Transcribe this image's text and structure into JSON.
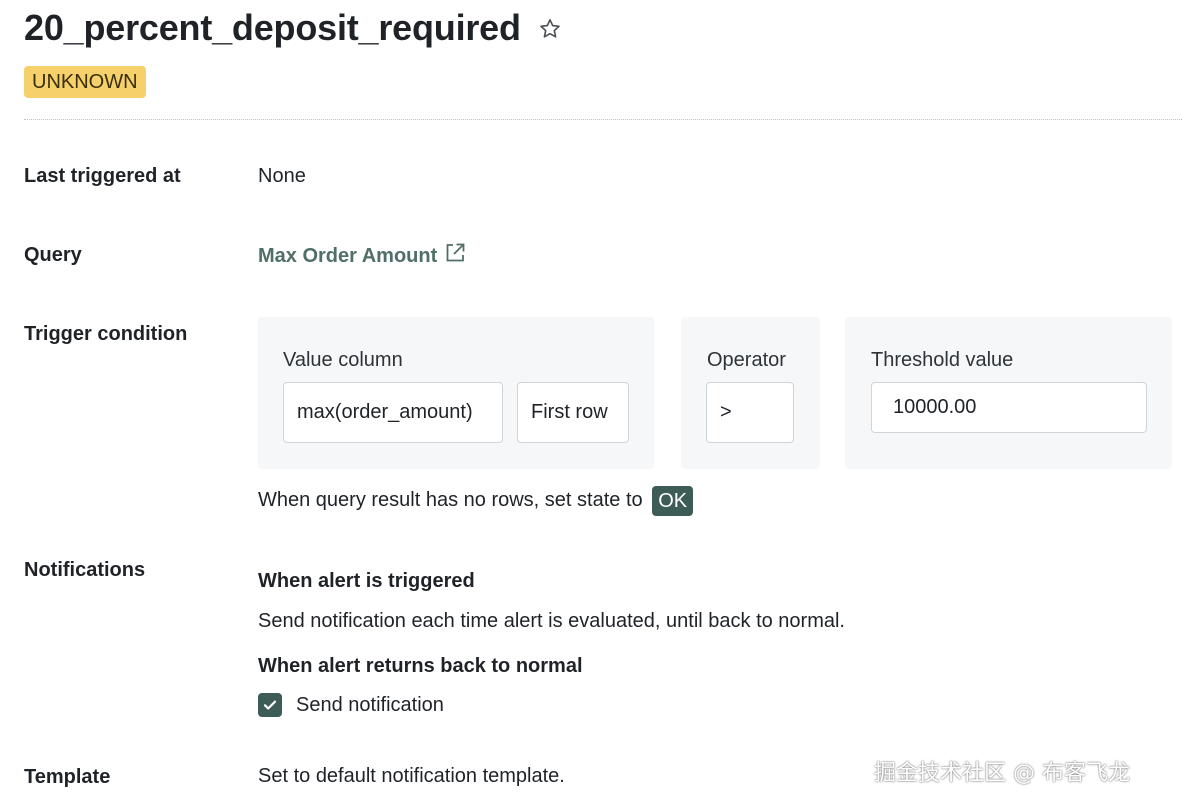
{
  "alert": {
    "title": "20_percent_deposit_required",
    "status": "UNKNOWN"
  },
  "colors": {
    "status_badge": "#f5d06b",
    "accent": "#3d5c57",
    "link": "#4f6f68"
  },
  "fields": {
    "last_triggered_label": "Last triggered at",
    "last_triggered_value": "None",
    "query_label": "Query",
    "query_link": "Max Order Amount",
    "trigger_label": "Trigger condition",
    "notifications_label": "Notifications",
    "template_label": "Template",
    "template_value": "Set to default notification template."
  },
  "trigger": {
    "value_column_label": "Value column",
    "value_column": "max(order_amount)",
    "row_selector": "First row",
    "operator_label": "Operator",
    "operator": ">",
    "threshold_label": "Threshold value",
    "threshold": "10000.00",
    "no_rows_text": "When query result has no rows, set state to",
    "no_rows_state": "OK"
  },
  "notifications": {
    "triggered_heading": "When alert is triggered",
    "triggered_text": "Send notification each time alert is evaluated, until back to normal.",
    "normal_heading": "When alert returns back to normal",
    "send_label": "Send notification",
    "send_checked": true
  },
  "watermark": "掘金技术社区 @ 布客飞龙"
}
